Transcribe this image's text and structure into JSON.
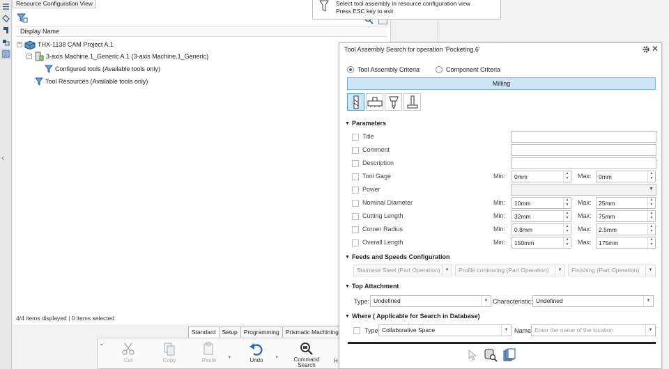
{
  "left_strip": {
    "icons": [
      "list-icon",
      "tag-icon",
      "tool-icon",
      "resource-icon",
      "panel-icon"
    ]
  },
  "resource_view": {
    "tab_title": "Resource Configuration View",
    "column_header": "Display Name",
    "tree": [
      {
        "label": "THX-1138 CAM Project A.1",
        "toggle": "−"
      },
      {
        "label": "3-axis Machine.1_Generic A.1 (3-axis Machine.1_Generic)",
        "toggle": "−"
      },
      {
        "label": "Configured tools (Available tools only)"
      },
      {
        "label": "Tool Resources (Available tools only)"
      }
    ],
    "footer": "4/4 items displayed | 0 items selected"
  },
  "tooltip": {
    "line1": "Select tool assembly in resource configuration view",
    "line2": "Press ESC key to exit"
  },
  "action_bar": {
    "tabs": [
      "Standard",
      "Setup",
      "Programming",
      "Prismatic Machining"
    ],
    "tools": {
      "cut": "Cut",
      "copy": "Copy",
      "paste": "Paste",
      "undo": "Undo",
      "command_search": "Command Search",
      "more": "H"
    }
  },
  "dialog": {
    "title": "Tool Assembly Search for operation 'Pocketing.6'",
    "criteria": {
      "assembly": "Tool Assembly Criteria",
      "component": "Component Criteria"
    },
    "category": "Milling",
    "tool_types": [
      "end-mill-icon",
      "face-mill-icon",
      "drill-icon",
      "t-slot-icon"
    ],
    "parameters_title": "Parameters",
    "min_label": "Min:",
    "max_label": "Max:",
    "params": {
      "title": "Title",
      "comment": "Comment",
      "description": "Description",
      "tool_gage": {
        "label": "Tool Gage",
        "min": "0mm",
        "max": "0mm"
      },
      "power": "Power",
      "nominal_diameter": {
        "label": "Nominal Diameter",
        "min": "10mm",
        "max": "25mm"
      },
      "cutting_length": {
        "label": "Cutting Length",
        "min": "32mm",
        "max": "75mm"
      },
      "corner_radius": {
        "label": "Corner Radius",
        "min": "0.8mm",
        "max": "2.5mm"
      },
      "overall_length": {
        "label": "Overall Length",
        "min": "150mm",
        "max": "175mm"
      }
    },
    "feeds_title": "Feeds and Speeds Configuration",
    "feeds": {
      "material": "Stainless Steel (Part Operation)",
      "operation": "Profile contouring (Part Operation)",
      "quality": "Finishing (Part Operation)"
    },
    "top_attachment": {
      "title": "Top Attachment",
      "type_label": "Type:",
      "type_value": "Undefined",
      "char_label": "Characteristic:",
      "char_value": "Undefined"
    },
    "where": {
      "title": "Where ( Applicable for Search in Database)",
      "type_label": "Type",
      "type_value": "Collaborative Space",
      "name_label": "Name",
      "name_placeholder": "Enter the name of the location"
    }
  }
}
